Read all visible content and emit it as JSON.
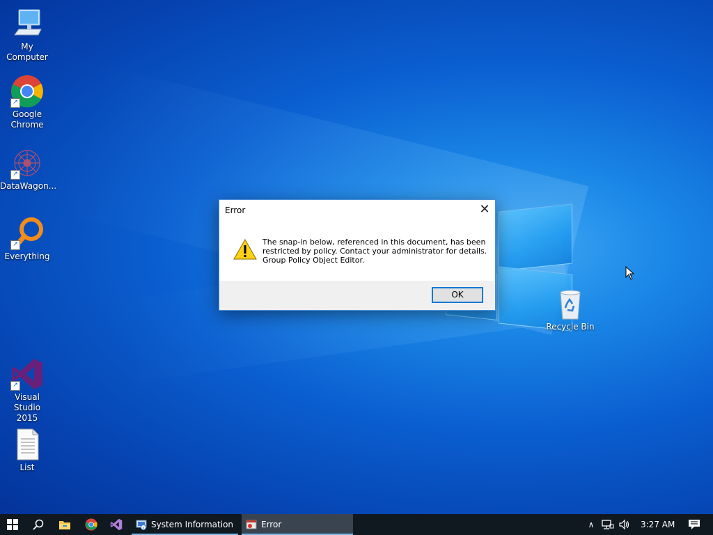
{
  "desktop": {
    "icons": [
      {
        "label": "My Computer",
        "icon": "computer-icon"
      },
      {
        "label": "Google Chrome",
        "icon": "chrome-icon"
      },
      {
        "label": "DataWagon...",
        "icon": "datawagon-icon"
      },
      {
        "label": "Everything",
        "icon": "everything-search-icon"
      },
      {
        "label": "Visual Studio 2015",
        "icon": "visual-studio-icon"
      },
      {
        "label": "List",
        "icon": "text-document-icon"
      },
      {
        "label": "Recycle Bin",
        "icon": "recycle-bin-icon"
      }
    ]
  },
  "dialog": {
    "title": "Error",
    "close_glyph": "✕",
    "message_lines": [
      "The snap-in below, referenced in this document, has been",
      "restricted by policy. Contact your administrator for details.",
      "Group Policy Object Editor."
    ],
    "ok_label": "OK",
    "icon": "warning-icon"
  },
  "taskbar": {
    "pinned": [
      "windows-start-icon",
      "search-icon",
      "file-explorer-icon",
      "chrome-icon",
      "visual-studio-icon"
    ],
    "tasks": [
      {
        "label": "System Information",
        "icon": "system-information-icon"
      },
      {
        "label": "Error",
        "icon": "error-window-icon"
      }
    ],
    "tray": {
      "chevron_glyph": "∧",
      "clock": "3:27 AM"
    },
    "accent": "#76b9ed"
  }
}
